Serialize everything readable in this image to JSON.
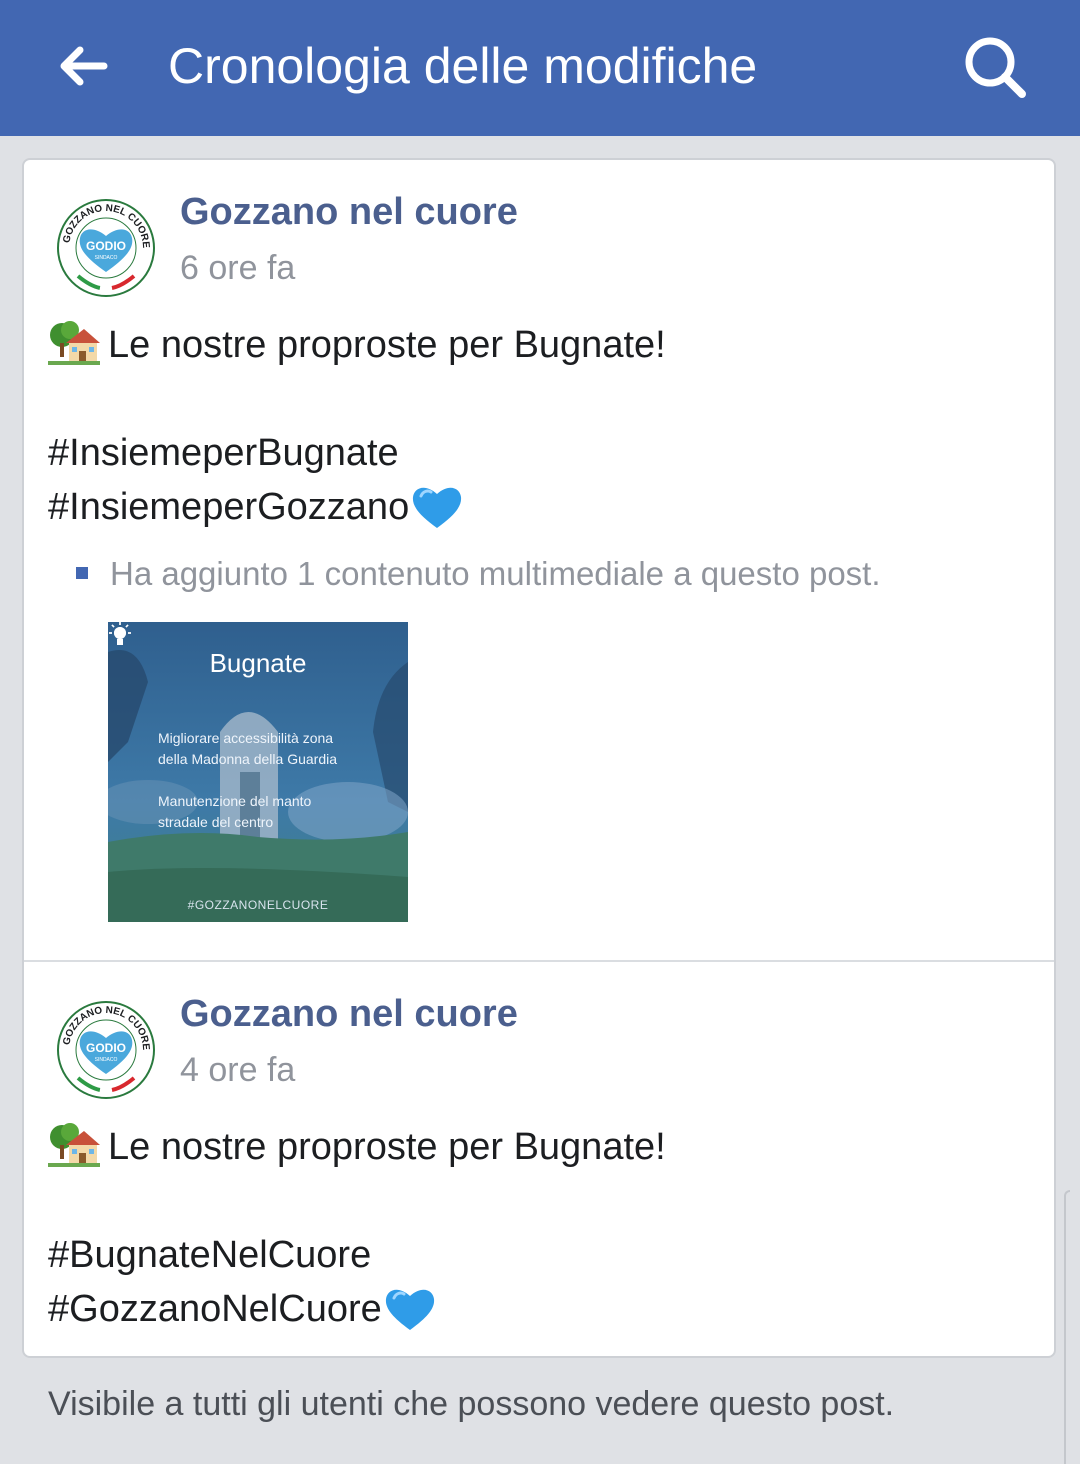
{
  "appbar": {
    "title": "Cronologia delle modifiche",
    "back_icon": "arrow-left-icon",
    "search_icon": "search-icon",
    "background_color": "#4267b2"
  },
  "entries": [
    {
      "author": "Gozzano nel cuore",
      "time": "6 ore fa",
      "avatar": {
        "ring_text": "GOZZANO NEL CUORE",
        "heart_text": "GODIO",
        "heart_subtext": "SINDACO"
      },
      "message": {
        "emoji_lead": "house-with-garden-emoji",
        "line1": "Le nostre proproste per Bugnate!",
        "hashtag1": "#InsiemeperBugnate",
        "hashtag2": "#InsiemeperGozzano",
        "emoji_trail": "blue-heart-emoji"
      },
      "change_note": "Ha aggiunto 1 contenuto multimediale a questo post.",
      "media": {
        "title": "Bugnate",
        "bullet1": "Migliorare accessibilità zona\ndella Madonna della Guardia",
        "bullet2": "Manutenzione    del    manto\nstradale del centro",
        "tag": "#GOZZANONELCUORE"
      }
    },
    {
      "author": "Gozzano nel cuore",
      "time": "4 ore fa",
      "avatar": {
        "ring_text": "GOZZANO NEL CUORE",
        "heart_text": "GODIO",
        "heart_subtext": "SINDACO"
      },
      "message": {
        "emoji_lead": "house-with-garden-emoji",
        "line1": "Le nostre proproste per Bugnate!",
        "hashtag1": "#BugnateNelCuore",
        "hashtag2": "#GozzanoNelCuore",
        "emoji_trail": "blue-heart-emoji"
      }
    }
  ],
  "footer": {
    "text": "Visibile a tutti gli utenti che possono vedere questo post."
  }
}
